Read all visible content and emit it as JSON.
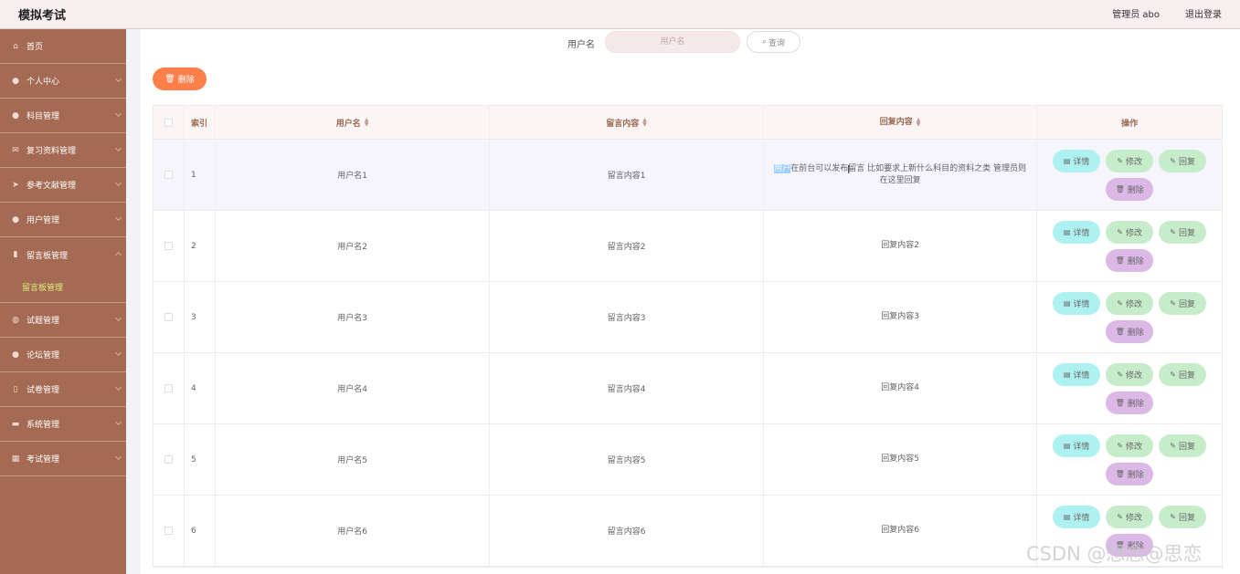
{
  "header": {
    "title": "模拟考试",
    "user": "管理员 abo",
    "logout": "退出登录"
  },
  "sidebar": {
    "items": [
      {
        "label": "首页",
        "icon": "home-icon"
      },
      {
        "label": "个人中心",
        "icon": "user-icon"
      },
      {
        "label": "科目管理",
        "icon": "user-icon"
      },
      {
        "label": "复习资料管理",
        "icon": "mail-icon"
      },
      {
        "label": "参考文献管理",
        "icon": "send-icon"
      },
      {
        "label": "用户管理",
        "icon": "user-icon"
      },
      {
        "label": "留言板管理",
        "icon": "chat-icon"
      },
      {
        "label": "留言板管理",
        "icon": ""
      },
      {
        "label": "试题管理",
        "icon": "globe-icon"
      },
      {
        "label": "论坛管理",
        "icon": "pin-icon"
      },
      {
        "label": "试卷管理",
        "icon": "phone-icon"
      },
      {
        "label": "系统管理",
        "icon": "case-icon"
      },
      {
        "label": "考试管理",
        "icon": "grid-icon"
      }
    ]
  },
  "search": {
    "label": "用户名",
    "placeholder": "用户名",
    "button": "查询"
  },
  "toolbar": {
    "delete": "删除"
  },
  "table": {
    "columns": {
      "index": "索引",
      "username": "用户名",
      "message": "留言内容",
      "reply": "回复内容",
      "action": "操作"
    },
    "rows": [
      {
        "index": "1",
        "username": "用户名1",
        "message": "留言内容1",
        "reply_highlight": "用户",
        "reply": "在前台可以发布留言 比如要求上新什么科目的资料之类 管理员则在这里回复"
      },
      {
        "index": "2",
        "username": "用户名2",
        "message": "留言内容2",
        "reply_highlight": "",
        "reply": "回复内容2"
      },
      {
        "index": "3",
        "username": "用户名3",
        "message": "留言内容3",
        "reply_highlight": "",
        "reply": "回复内容3"
      },
      {
        "index": "4",
        "username": "用户名4",
        "message": "留言内容4",
        "reply_highlight": "",
        "reply": "回复内容4"
      },
      {
        "index": "5",
        "username": "用户名5",
        "message": "留言内容5",
        "reply_highlight": "",
        "reply": "回复内容5"
      },
      {
        "index": "6",
        "username": "用户名6",
        "message": "留言内容6",
        "reply_highlight": "",
        "reply": "回复内容6"
      }
    ],
    "actions": {
      "detail": "详情",
      "edit": "修改",
      "reply": "回复",
      "delete": "删除"
    }
  },
  "watermark": "CSDN @想念@思恋",
  "colors": {
    "sidebar": "#a56a53",
    "accent": "#ff7f4a",
    "header": "#f7eef0"
  }
}
